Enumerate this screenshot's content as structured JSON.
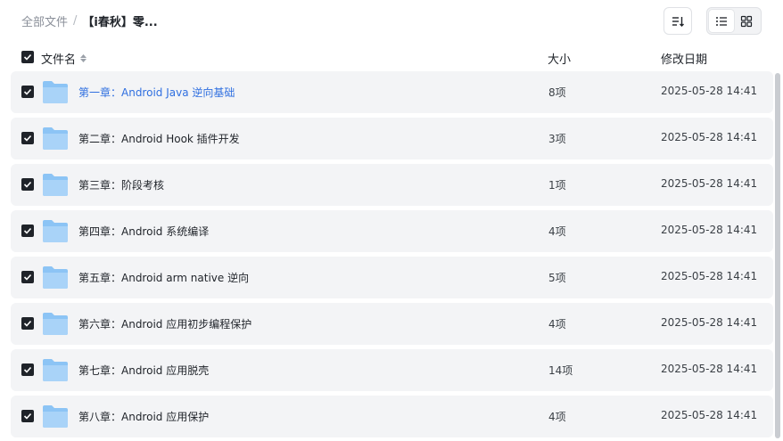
{
  "breadcrumb": {
    "root": "全部文件",
    "separator": "/",
    "current": "【i春秋】零..."
  },
  "toolbar": {
    "sort_icon": "sort-icon",
    "list_view_icon": "list-view-icon",
    "grid_view_icon": "grid-view-icon",
    "active_view": "list"
  },
  "table": {
    "columns": {
      "name": "文件名",
      "size": "大小",
      "modified": "修改日期"
    },
    "rows": [
      {
        "name": "第一章：Android Java 逆向基础",
        "size": "8项",
        "date": "2025-05-28 14:41"
      },
      {
        "name": "第二章：Android Hook 插件开发",
        "size": "3项",
        "date": "2025-05-28 14:41"
      },
      {
        "name": "第三章：阶段考核",
        "size": "1项",
        "date": "2025-05-28 14:41"
      },
      {
        "name": "第四章：Android 系统编译",
        "size": "4项",
        "date": "2025-05-28 14:41"
      },
      {
        "name": "第五章：Android arm native 逆向",
        "size": "5项",
        "date": "2025-05-28 14:41"
      },
      {
        "name": "第六章：Android 应用初步编程保护",
        "size": "4项",
        "date": "2025-05-28 14:41"
      },
      {
        "name": "第七章：Android 应用脱壳",
        "size": "14项",
        "date": "2025-05-28 14:41"
      },
      {
        "name": "第八章：Android 应用保护",
        "size": "4项",
        "date": "2025-05-28 14:41"
      }
    ]
  },
  "colors": {
    "row_background": "#f3f4f6",
    "highlight_text": "#2f6fe0",
    "folder_blue": "#8cc4f5"
  }
}
